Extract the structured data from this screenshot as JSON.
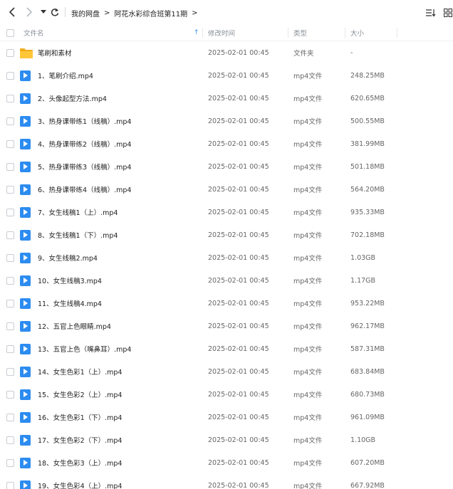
{
  "nav": {
    "back_glyph": "back-arrow-icon",
    "forward_glyph": "forward-arrow-icon",
    "dropdown_glyph": "chevron-down-icon",
    "refresh_glyph": "refresh-icon"
  },
  "breadcrumb": {
    "items": [
      "我的网盘",
      "阿花水彩综合班第11期"
    ],
    "separator": ">",
    "trailing": ">"
  },
  "view": {
    "sort_icon": "sort-list-icon",
    "grid_icon": "grid-view-icon"
  },
  "header": {
    "name": "文件名",
    "sort_arrow": "↑",
    "time": "修改时间",
    "type": "类型",
    "size": "大小"
  },
  "colors": {
    "accent": "#2d8cf0",
    "folder": "#ffc63a",
    "folder_dark": "#f0ac1b"
  },
  "files": [
    {
      "name": "笔刷和素材",
      "time": "2025-02-01 00:45",
      "type": "文件夹",
      "size": "-",
      "icon": "folder"
    },
    {
      "name": "1、笔刷介绍.mp4",
      "time": "2025-02-01 00:45",
      "type": "mp4文件",
      "size": "248.25MB",
      "icon": "video"
    },
    {
      "name": "2、头像起型方法.mp4",
      "time": "2025-02-01 00:45",
      "type": "mp4文件",
      "size": "620.65MB",
      "icon": "video"
    },
    {
      "name": "3、热身课带练1（线稿）.mp4",
      "time": "2025-02-01 00:45",
      "type": "mp4文件",
      "size": "500.55MB",
      "icon": "video"
    },
    {
      "name": "4、热身课带练2（线稿）.mp4",
      "time": "2025-02-01 00:45",
      "type": "mp4文件",
      "size": "381.99MB",
      "icon": "video"
    },
    {
      "name": "5、热身课带练3（线稿）.mp4",
      "time": "2025-02-01 00:45",
      "type": "mp4文件",
      "size": "501.18MB",
      "icon": "video"
    },
    {
      "name": "6、热身课带练4（线稿）.mp4",
      "time": "2025-02-01 00:45",
      "type": "mp4文件",
      "size": "564.20MB",
      "icon": "video"
    },
    {
      "name": "7、女生线稿1（上）.mp4",
      "time": "2025-02-01 00:45",
      "type": "mp4文件",
      "size": "935.33MB",
      "icon": "video"
    },
    {
      "name": "8、女生线稿1（下）.mp4",
      "time": "2025-02-01 00:45",
      "type": "mp4文件",
      "size": "702.18MB",
      "icon": "video"
    },
    {
      "name": "9、女生线稿2.mp4",
      "time": "2025-02-01 00:45",
      "type": "mp4文件",
      "size": "1.03GB",
      "icon": "video"
    },
    {
      "name": "10、女生线稿3.mp4",
      "time": "2025-02-01 00:45",
      "type": "mp4文件",
      "size": "1.17GB",
      "icon": "video"
    },
    {
      "name": "11、女生线稿4.mp4",
      "time": "2025-02-01 00:45",
      "type": "mp4文件",
      "size": "953.22MB",
      "icon": "video"
    },
    {
      "name": "12、五官上色眼睛.mp4",
      "time": "2025-02-01 00:45",
      "type": "mp4文件",
      "size": "962.17MB",
      "icon": "video"
    },
    {
      "name": "13、五官上色（嘴鼻耳）.mp4",
      "time": "2025-02-01 00:45",
      "type": "mp4文件",
      "size": "587.31MB",
      "icon": "video"
    },
    {
      "name": "14、女生色彩1（上）.mp4",
      "time": "2025-02-01 00:45",
      "type": "mp4文件",
      "size": "683.84MB",
      "icon": "video"
    },
    {
      "name": "15、女生色彩2（上）.mp4",
      "time": "2025-02-01 00:45",
      "type": "mp4文件",
      "size": "680.73MB",
      "icon": "video"
    },
    {
      "name": "16、女生色彩1（下）.mp4",
      "time": "2025-02-01 00:45",
      "type": "mp4文件",
      "size": "961.09MB",
      "icon": "video"
    },
    {
      "name": "17、女生色彩2（下）.mp4",
      "time": "2025-02-01 00:45",
      "type": "mp4文件",
      "size": "1.10GB",
      "icon": "video"
    },
    {
      "name": "18、女生色彩3（上）.mp4",
      "time": "2025-02-01 00:45",
      "type": "mp4文件",
      "size": "607.20MB",
      "icon": "video"
    },
    {
      "name": "19、女生色彩4（上）.mp4",
      "time": "2025-02-01 00:45",
      "type": "mp4文件",
      "size": "667.92MB",
      "icon": "video"
    }
  ]
}
